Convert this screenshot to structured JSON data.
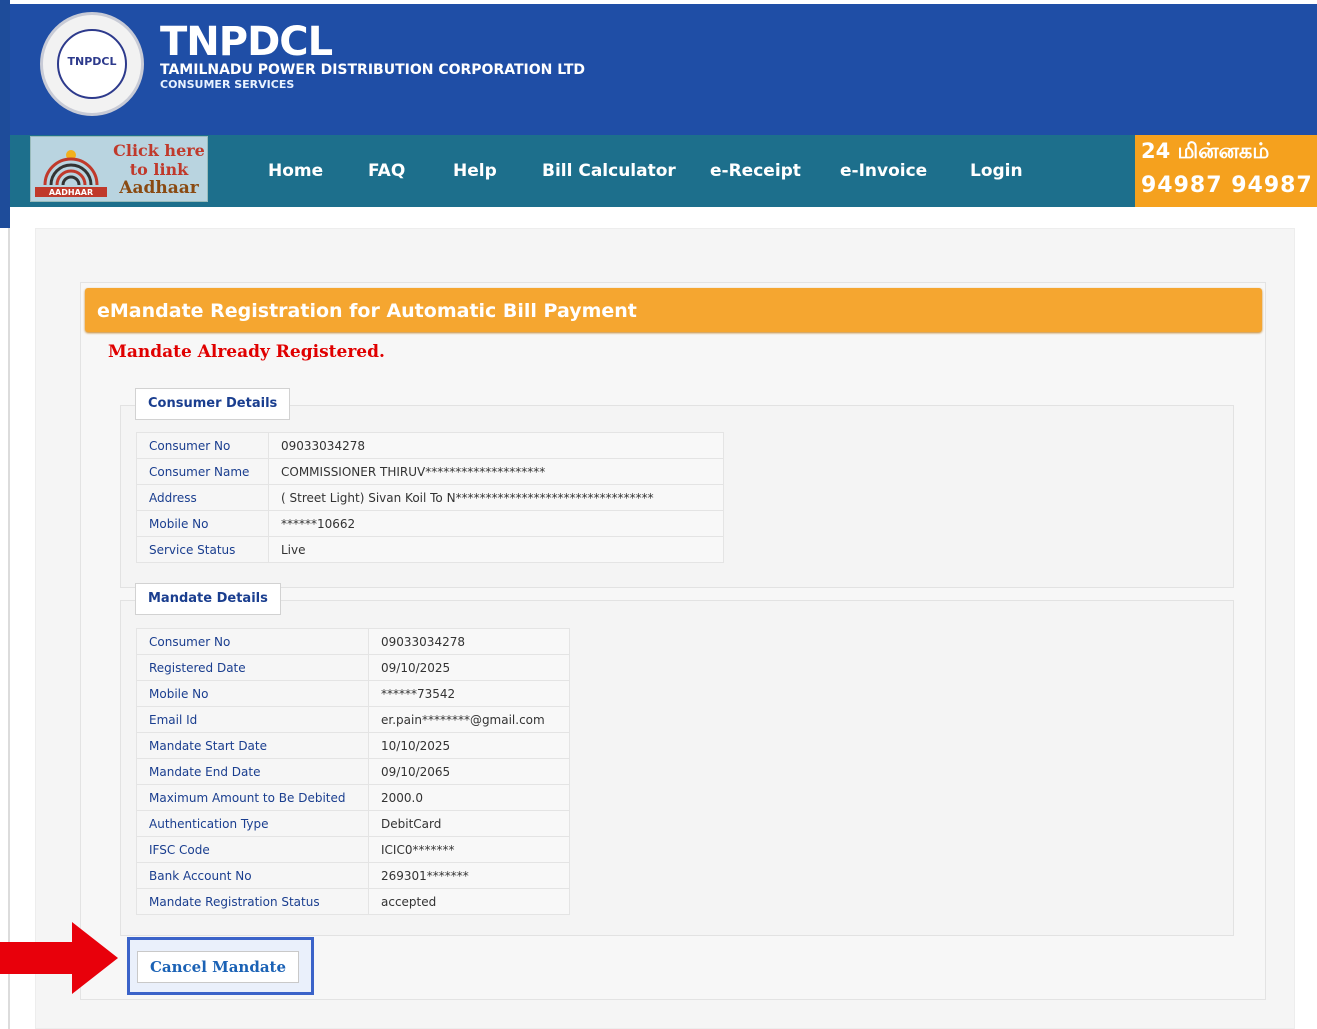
{
  "header": {
    "logo_text": "TNPDCL",
    "brand_name": "TNPDCL",
    "brand_full": "TAMILNADU POWER DISTRIBUTION CORPORATION LTD",
    "brand_sub": "CONSUMER SERVICES"
  },
  "aadhaar": {
    "line1": "Click here",
    "line2": "to link",
    "line3": "Aadhaar",
    "logo_caption": "AADHAAR"
  },
  "nav": {
    "items": [
      "Home",
      "FAQ",
      "Help",
      "Bill Calculator",
      "e-Receipt",
      "e-Invoice",
      "Login"
    ]
  },
  "helpline": {
    "title": "24 மின்னகம்",
    "number": "94987 94987"
  },
  "main": {
    "title": "eMandate Registration for Automatic Bill Payment",
    "alert": "Mandate Already Registered."
  },
  "consumer": {
    "legend": "Consumer Details",
    "rows": [
      {
        "label": "Consumer No",
        "value": "09033034278"
      },
      {
        "label": "Consumer Name",
        "value": "COMMISSIONER THIRUV********************"
      },
      {
        "label": "Address",
        "value": "( Street Light) Sivan Koil To N*********************************"
      },
      {
        "label": "Mobile No",
        "value": "******10662"
      },
      {
        "label": "Service Status",
        "value": "Live"
      }
    ]
  },
  "mandate": {
    "legend": "Mandate Details",
    "rows": [
      {
        "label": "Consumer No",
        "value": "09033034278"
      },
      {
        "label": "Registered Date",
        "value": "09/10/2025"
      },
      {
        "label": "Mobile No",
        "value": "******73542"
      },
      {
        "label": "Email Id",
        "value": "er.pain********@gmail.com"
      },
      {
        "label": "Mandate Start Date",
        "value": "10/10/2025"
      },
      {
        "label": "Mandate End Date",
        "value": "09/10/2065"
      },
      {
        "label": "Maximum Amount to Be Debited",
        "value": "2000.0"
      },
      {
        "label": "Authentication Type",
        "value": "DebitCard"
      },
      {
        "label": "IFSC Code",
        "value": "ICIC0*******"
      },
      {
        "label": "Bank Account No",
        "value": "269301*******"
      },
      {
        "label": "Mandate Registration Status",
        "value": "accepted"
      }
    ]
  },
  "actions": {
    "cancel_label": "Cancel Mandate"
  },
  "colors": {
    "header_blue": "#1f4ea6",
    "nav_teal": "#1d6f8c",
    "title_orange": "#f5a630",
    "alert_red": "#e00000",
    "label_blue": "#1a3e8f",
    "arrow_red": "#e8000b"
  }
}
